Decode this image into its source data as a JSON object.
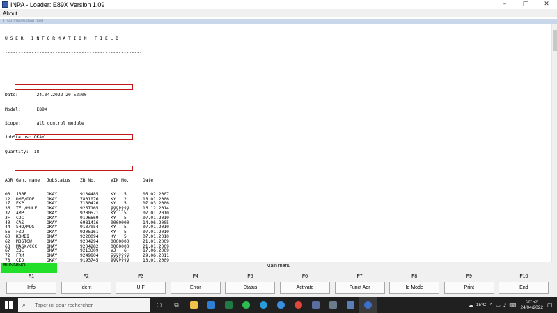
{
  "window": {
    "title": "INPA - Loader: E89X Version 1.09",
    "buttons": {
      "minimize": "–",
      "maximize": "□",
      "close": "✕"
    }
  },
  "menubar": {
    "about": "About..."
  },
  "caption_strip": "User Information field",
  "report": {
    "heading": "U S E R   I N F O R M A T I O N   F I E L D",
    "heading_rule": "----------------------------------------------------",
    "date": "Date:       24.04.2022 20:52:00",
    "model": "Model:      E89X",
    "scope": "Scope:      all control module",
    "jobstatus": "JobStatus: OKAY",
    "quantity": "Quantity:  18",
    "separator": "------------------------------------------------------------------------------------",
    "columns": {
      "adr": "ADR",
      "name": "Gen. name",
      "status": "JobStatus",
      "zb": "ZB No.",
      "vin": "VIN No.",
      "date": "Date"
    },
    "rows": [
      {
        "adr": "00",
        "name": "JBBF",
        "status": "OKAY",
        "zb": "9134485",
        "vin": "KY   5",
        "date": "05.02.2007"
      },
      {
        "adr": "12",
        "name": "DME/DDE",
        "status": "OKAY",
        "zb": "7801076",
        "vin": "KY   2",
        "date": "18.01.2006"
      },
      {
        "adr": "17",
        "name": "EKP",
        "status": "OKAY",
        "zb": "7180426",
        "vin": "KY   5",
        "date": "07.03.2006"
      },
      {
        "adr": "36",
        "name": "TEL/MULF",
        "status": "OKAY",
        "zb": "9257165",
        "vin": "ÿÿÿÿÿÿÿ",
        "date": "16.12.2014"
      },
      {
        "adr": "37",
        "name": "AMP",
        "status": "OKAY",
        "zb": "9200571",
        "vin": "KY   5",
        "date": "07.01.2010"
      },
      {
        "adr": "3F",
        "name": "CDC",
        "status": "OKAY",
        "zb": "9196669",
        "vin": "KY   5",
        "date": "07.01.2010"
      },
      {
        "adr": "40",
        "name": "CAS",
        "status": "OKAY",
        "zb": "6981416",
        "vin": "0000000",
        "date": "14.06.2005"
      },
      {
        "adr": "44",
        "name": "SHD/MDS",
        "status": "OKAY",
        "zb": "9137054",
        "vin": "KY   5",
        "date": "07.01.2010"
      },
      {
        "adr": "56",
        "name": "FZD",
        "status": "OKAY",
        "zb": "9205161",
        "vin": "KY   5",
        "date": "07.01.2010"
      },
      {
        "adr": "60",
        "name": "KOMBI",
        "status": "OKAY",
        "zb": "9220094",
        "vin": "KY   5",
        "date": "07.01.2010"
      },
      {
        "adr": "62",
        "name": "MOSTGW",
        "status": "OKAY",
        "zb": "9204294",
        "vin": "0000000",
        "date": "21.01.2009"
      },
      {
        "adr": "63",
        "name": "MASK/CCC",
        "status": "OKAY",
        "zb": "9204282",
        "vin": "0000000",
        "date": "21.01.2009"
      },
      {
        "adr": "67",
        "name": "ZBE",
        "status": "OKAY",
        "zb": "9213309",
        "vin": "VJ   6",
        "date": "17.06.2009"
      },
      {
        "adr": "72",
        "name": "FRM",
        "status": "OKAY",
        "zb": "9249804",
        "vin": "ÿÿÿÿÿÿÿ",
        "date": "29.06.2011"
      },
      {
        "adr": "73",
        "name": "CID",
        "status": "OKAY",
        "zb": "9193745",
        "vin": "ÿÿÿÿÿÿÿ",
        "date": "13.01.2009"
      },
      {
        "adr": "78",
        "name": "KLIMA",
        "status": "OKAY",
        "zb": "9199259",
        "vin": "KY   5",
        "date": "07.01.2010"
      },
      {
        "adr": "92",
        "name": "VIDTSG92",
        "status": "OKAY",
        "zb": "9180490",
        "vin": "0000000",
        "date": "21.01.2009"
      },
      {
        "adr": "A0",
        "name": "CCC",
        "status": "OKAY",
        "zb": "9204296",
        "vin": "0000000",
        "date": "21.01.2009"
      }
    ],
    "highlight_color": "#c01818"
  },
  "statusbar": {
    "running": "RUNNING",
    "running_color": "#22e02a",
    "title": "Main menu"
  },
  "fkeys": [
    {
      "key": "F1",
      "label": "Info"
    },
    {
      "key": "F2",
      "label": "Ident"
    },
    {
      "key": "F3",
      "label": "UIF"
    },
    {
      "key": "F4",
      "label": "Error"
    },
    {
      "key": "F5",
      "label": "Status"
    },
    {
      "key": "F6",
      "label": "Activate"
    },
    {
      "key": "F7",
      "label": "Funct Adr"
    },
    {
      "key": "F8",
      "label": "Id Mode"
    },
    {
      "key": "F9",
      "label": "Print"
    },
    {
      "key": "F10",
      "label": "End"
    }
  ],
  "taskbar": {
    "search_placeholder": "Taper ici pour rechercher",
    "temperature": "15°C",
    "time": "20:52",
    "date": "24/04/2022"
  }
}
